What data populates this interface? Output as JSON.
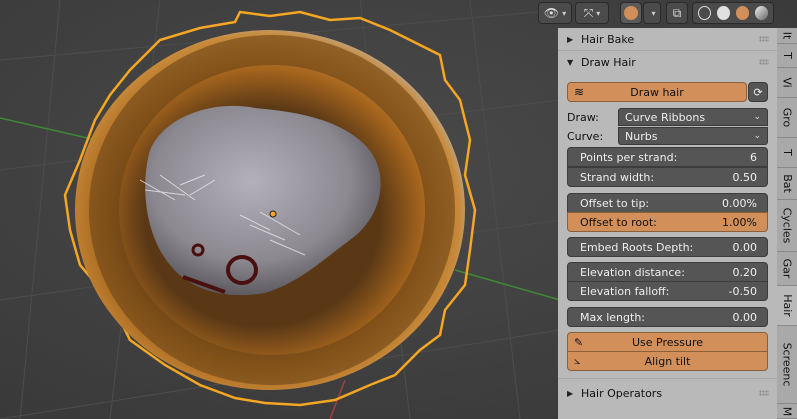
{
  "toolbar": {
    "visibility_icon": "eye-icon",
    "gizmo_icon": "gizmo-arrows-icon",
    "overlay_icon": "overlay-spheres-icon",
    "xray_icon": "xray-square-icon",
    "shading_modes": [
      "wireframe",
      "solid",
      "material-preview",
      "rendered"
    ],
    "active_shading": "material-preview"
  },
  "panels": {
    "hair_bake": {
      "title": "Hair Bake",
      "expanded": false
    },
    "draw_hair": {
      "title": "Draw Hair",
      "expanded": true,
      "draw_button": "Draw hair",
      "draw_label": "Draw:",
      "draw_value": "Curve Ribbons",
      "curve_label": "Curve:",
      "curve_value": "Nurbs",
      "points_label": "Points per strand:",
      "points_value": "6",
      "width_label": "Strand width:",
      "width_value": "0.50",
      "offset_tip_label": "Offset to tip:",
      "offset_tip_value": "0.00%",
      "offset_root_label": "Offset to root:",
      "offset_root_value": "1.00%",
      "embed_label": "Embed Roots Depth:",
      "embed_value": "0.00",
      "elev_dist_label": "Elevation distance:",
      "elev_dist_value": "0.20",
      "elev_falloff_label": "Elevation falloff:",
      "elev_falloff_value": "-0.50",
      "max_len_label": "Max length:",
      "max_len_value": "0.00",
      "pressure_button": "Use Pressure",
      "align_button": "Align tilt"
    },
    "hair_operators": {
      "title": "Hair Operators",
      "expanded": false
    }
  },
  "tabs": [
    "It",
    "T",
    "Vi",
    "Gro",
    "T",
    "Bat",
    "Cycles",
    "Gar",
    "Hair",
    "Screenc",
    "M"
  ],
  "active_tab": "Hair",
  "colors": {
    "accent": "#d28f5a",
    "field": "#555555",
    "panel": "#b9b9b9",
    "selection_outline": "#f5a623",
    "axis_x": "#c05050",
    "axis_y": "#5aa03c"
  }
}
